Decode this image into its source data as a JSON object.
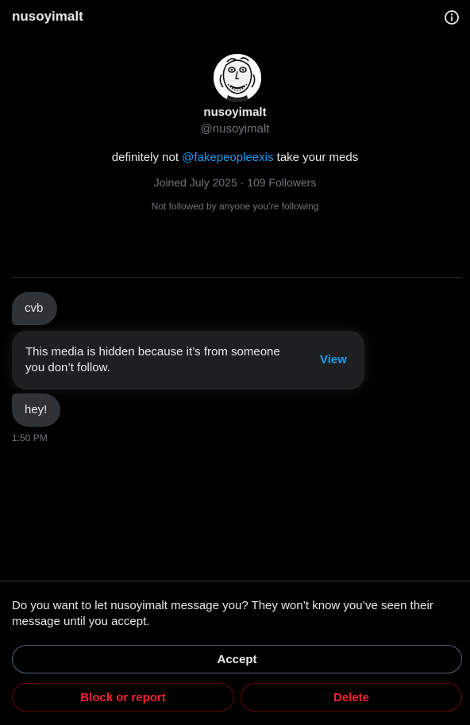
{
  "header": {
    "title": "nusoyimalt",
    "info_icon": "info-circle-icon"
  },
  "profile": {
    "avatar_icon": "avatar-cartoon",
    "name": "nusoyimalt",
    "handle": "@nusoyimalt",
    "bio_prefix": "definitely not ",
    "bio_mention": "@fakepeopleexis",
    "bio_suffix": " take your meds",
    "joined": "Joined July 2025",
    "separator": " · ",
    "followers": "109 Followers",
    "not_followed": "Not followed by anyone you’re following"
  },
  "messages": {
    "first": "cvb",
    "media_notice": "This media is hidden because it’s from someone you don’t follow.",
    "media_view": "View",
    "last": "hey!",
    "timestamp": "1:50 PM"
  },
  "request": {
    "prompt": "Do you want to let nusoyimalt message you? They won’t know you’ve seen their message until you accept.",
    "accept": "Accept",
    "block": "Block or report",
    "delete": "Delete"
  },
  "colors": {
    "background": "#000000",
    "link": "#1d9bf0",
    "danger": "#f4212e",
    "bubble": "#2f3336",
    "muted": "#71767b"
  }
}
